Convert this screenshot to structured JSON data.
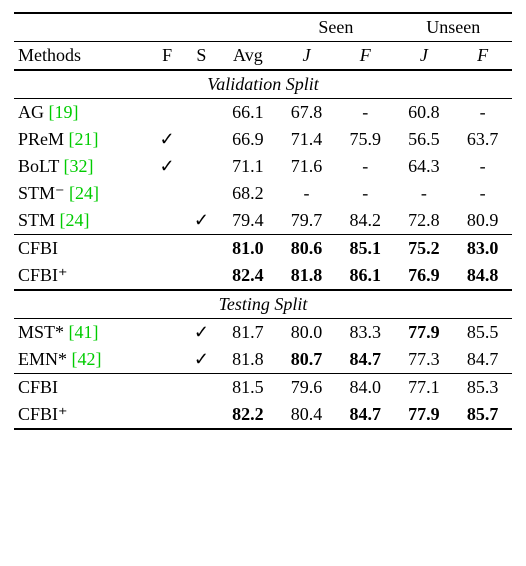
{
  "header": {
    "methods": "Methods",
    "f": "F",
    "s": "S",
    "avg": "Avg",
    "seen": "Seen",
    "unseen": "Unseen",
    "J": "J",
    "Fscr": "F"
  },
  "sections": [
    {
      "title": "Validation Split",
      "rows": [
        {
          "name": "AG ",
          "ref": "[19]",
          "f": "",
          "s": "",
          "avg": "66.1",
          "sj": "67.8",
          "sf": "-",
          "uj": "60.8",
          "uf": "-",
          "bold": []
        },
        {
          "name": "PReM ",
          "ref": "[21]",
          "f": "✓",
          "s": "",
          "avg": "66.9",
          "sj": "71.4",
          "sf": "75.9",
          "uj": "56.5",
          "uf": "63.7",
          "bold": []
        },
        {
          "name": "BoLT ",
          "ref": "[32]",
          "f": "✓",
          "s": "",
          "avg": "71.1",
          "sj": "71.6",
          "sf": "-",
          "uj": "64.3",
          "uf": "-",
          "bold": []
        },
        {
          "name": "STM⁻ ",
          "ref": "[24]",
          "f": "",
          "s": "",
          "avg": "68.2",
          "sj": "-",
          "sf": "-",
          "uj": "-",
          "uf": "-",
          "bold": []
        },
        {
          "name": "STM ",
          "ref": "[24]",
          "f": "",
          "s": "✓",
          "avg": "79.4",
          "sj": "79.7",
          "sf": "84.2",
          "uj": "72.8",
          "uf": "80.9",
          "bold": []
        }
      ],
      "rows2": [
        {
          "name": "CFBI",
          "ref": "",
          "f": "",
          "s": "",
          "avg": "81.0",
          "sj": "80.6",
          "sf": "85.1",
          "uj": "75.2",
          "uf": "83.0",
          "bold": [
            "avg",
            "sj",
            "sf",
            "uj",
            "uf"
          ]
        },
        {
          "name": "CFBI⁺",
          "ref": "",
          "f": "",
          "s": "",
          "avg": "82.4",
          "sj": "81.8",
          "sf": "86.1",
          "uj": "76.9",
          "uf": "84.8",
          "bold": [
            "avg",
            "sj",
            "sf",
            "uj",
            "uf"
          ]
        }
      ]
    },
    {
      "title": "Testing Split",
      "rows": [
        {
          "name": "MST* ",
          "ref": "[41]",
          "f": "",
          "s": "✓",
          "avg": "81.7",
          "sj": "80.0",
          "sf": "83.3",
          "uj": "77.9",
          "uf": "85.5",
          "bold": [
            "uj"
          ]
        },
        {
          "name": "EMN* ",
          "ref": "[42]",
          "f": "",
          "s": "✓",
          "avg": "81.8",
          "sj": "80.7",
          "sf": "84.7",
          "uj": "77.3",
          "uf": "84.7",
          "bold": [
            "sj",
            "sf"
          ]
        }
      ],
      "rows2": [
        {
          "name": "CFBI",
          "ref": "",
          "f": "",
          "s": "",
          "avg": "81.5",
          "sj": "79.6",
          "sf": "84.0",
          "uj": "77.1",
          "uf": "85.3",
          "bold": []
        },
        {
          "name": "CFBI⁺",
          "ref": "",
          "f": "",
          "s": "",
          "avg": "82.2",
          "sj": "80.4",
          "sf": "84.7",
          "uj": "77.9",
          "uf": "85.7",
          "bold": [
            "avg",
            "sf",
            "uj",
            "uf"
          ]
        }
      ]
    }
  ]
}
